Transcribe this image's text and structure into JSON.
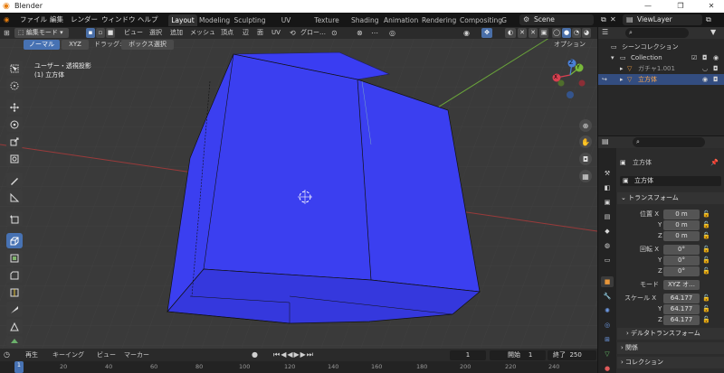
{
  "titlebar": {
    "app_title": "Blender",
    "minimize": "—",
    "maximize": "❐",
    "close": "✕"
  },
  "menubar": {
    "items": [
      "ファイル",
      "編集",
      "レンダー",
      "ウィンドウ",
      "ヘルプ"
    ],
    "workspaces": [
      "Layout",
      "Modeling",
      "Sculpting",
      "UV Editing",
      "Texture Paint",
      "Shading",
      "Animation",
      "Rendering",
      "Compositing",
      "G"
    ],
    "active_workspace": "Layout",
    "scene": "Scene",
    "view_layer": "ViewLayer"
  },
  "viewport_header": {
    "mode": "編集モード",
    "menus": [
      "ビュー",
      "選択",
      "追加",
      "メッシュ",
      "頂点",
      "辺",
      "面",
      "UV"
    ],
    "transform_orientation": "グロー…"
  },
  "viewport_sub": {
    "orientation_btn": "ノーマル",
    "axis_btn": "XYZ",
    "drag_label": "ドラッグ:",
    "drag_value": "ボックス選択",
    "options": "オプション"
  },
  "overlay": {
    "view_name": "ユーザー・透視投影",
    "object_name": "(1) 立方体"
  },
  "gizmo": {
    "x": "X",
    "y": "Y",
    "z": "Z"
  },
  "timeline": {
    "playback": "再生",
    "keying": "キーイング",
    "view": "ビュー",
    "marker": "マーカー",
    "current_frame": "1",
    "start_label": "開始",
    "start": "1",
    "end_label": "終了",
    "end": "250",
    "ruler": [
      "1",
      "20",
      "40",
      "60",
      "80",
      "100",
      "120",
      "140",
      "160",
      "180",
      "200",
      "220",
      "240"
    ]
  },
  "outliner": {
    "root": "シーンコレクション",
    "collection": "Collection",
    "items": [
      {
        "name": "ガチャ1.001",
        "selected": false
      },
      {
        "name": "立方体",
        "selected": true
      }
    ]
  },
  "properties": {
    "object_header": "立方体",
    "object_name_field": "立方体",
    "transform_panel": "トランスフォーム",
    "location_label": "位置 X",
    "location": [
      "0 m",
      "0 m",
      "0 m"
    ],
    "rotation_label": "回転 X",
    "rotation": [
      "0°",
      "0°",
      "0°"
    ],
    "mode_label": "モード",
    "mode_value": "XYZ オ…",
    "scale_label": "スケール X",
    "scale": [
      "64.177",
      "64.177",
      "64.177"
    ],
    "axis_y": "Y",
    "axis_z": "Z",
    "delta_panel": "デルタトランスフォーム",
    "relations_panel": "関係",
    "collection_panel": "コレクション"
  },
  "colors": {
    "mesh_face": "#3b3ff0",
    "mesh_bottom": "#3538dd",
    "active_tab": "#4772b3",
    "selection": "#334d80"
  }
}
